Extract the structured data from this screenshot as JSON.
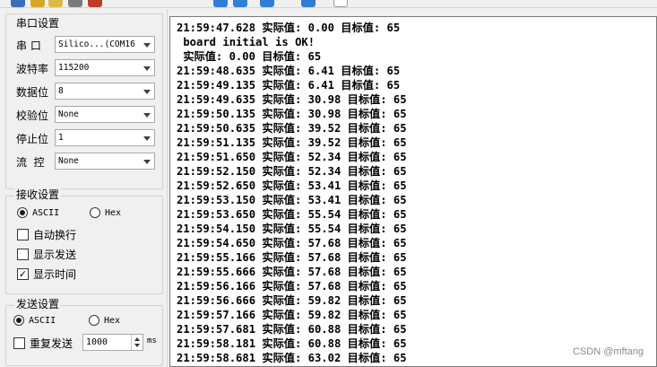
{
  "serial_settings": {
    "title": "串口设置",
    "port_label": "串 口",
    "port_value": "Silico...(COM16",
    "baud_label": "波特率",
    "baud_value": "115200",
    "databits_label": "数据位",
    "databits_value": "8",
    "parity_label": "校验位",
    "parity_value": "None",
    "stopbits_label": "停止位",
    "stopbits_value": "1",
    "flow_label": "流  控",
    "flow_value": "None"
  },
  "receive_settings": {
    "title": "接收设置",
    "ascii_label": "ASCII",
    "hex_label": "Hex",
    "mode_selected": "ASCII",
    "auto_wrap_label": "自动换行",
    "auto_wrap": false,
    "show_send_label": "显示发送",
    "show_send": false,
    "show_time_label": "显示时间",
    "show_time": true,
    "check_mark": "✓"
  },
  "send_settings": {
    "title": "发送设置",
    "ascii_label": "ASCII",
    "hex_label": "Hex",
    "mode_selected": "ASCII",
    "repeat_label": "重复发送",
    "repeat": false,
    "interval_value": "1000",
    "interval_unit": "ms"
  },
  "receive_lines": [
    "21:59:47.628 实际值: 0.00 目标值: 65",
    " board initial is OK!",
    " 实际值: 0.00 目标值: 65",
    "21:59:48.635 实际值: 6.41 目标值: 65",
    "21:59:49.135 实际值: 6.41 目标值: 65",
    "21:59:49.635 实际值: 30.98 目标值: 65",
    "21:59:50.135 实际值: 30.98 目标值: 65",
    "21:59:50.635 实际值: 39.52 目标值: 65",
    "21:59:51.135 实际值: 39.52 目标值: 65",
    "21:59:51.650 实际值: 52.34 目标值: 65",
    "21:59:52.150 实际值: 52.34 目标值: 65",
    "21:59:52.650 实际值: 53.41 目标值: 65",
    "21:59:53.150 实际值: 53.41 目标值: 65",
    "21:59:53.650 实际值: 55.54 目标值: 65",
    "21:59:54.150 实际值: 55.54 目标值: 65",
    "21:59:54.650 实际值: 57.68 目标值: 65",
    "21:59:55.166 实际值: 57.68 目标值: 65",
    "21:59:55.666 实际值: 57.68 目标值: 65",
    "21:59:56.166 实际值: 57.68 目标值: 65",
    "21:59:56.666 实际值: 59.82 目标值: 65",
    "21:59:57.166 实际值: 59.82 目标值: 65",
    "21:59:57.681 实际值: 60.88 目标值: 65",
    "21:59:58.181 实际值: 60.88 目标值: 65",
    "21:59:58.681 实际值: 63.02 目标值: 65"
  ],
  "watermark": "CSDN @mftang",
  "colors": {
    "toolbar_accent": "#2f7fd8"
  }
}
